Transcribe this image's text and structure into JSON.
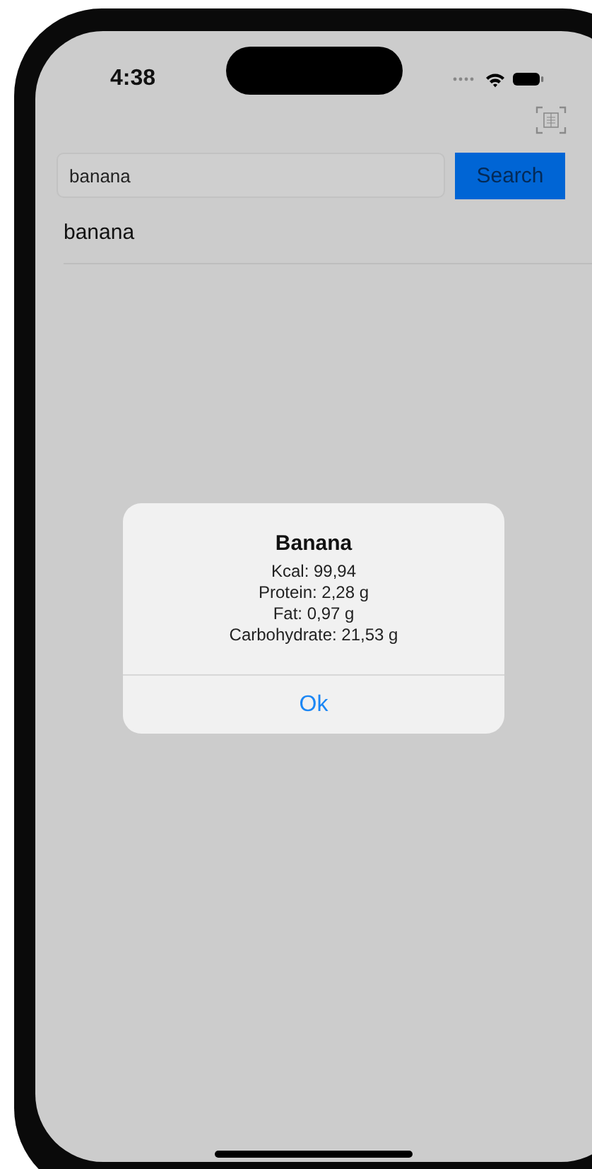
{
  "status_bar": {
    "time": "4:38"
  },
  "search": {
    "value": "banana",
    "button": "Search"
  },
  "results": [
    {
      "label": "banana"
    }
  ],
  "alert": {
    "title": "Banana",
    "lines": [
      "Kcal: 99,94",
      "Protein: 2,28 g",
      "Fat: 0,97 g",
      "Carbohydrate: 21,53 g"
    ],
    "button": "Ok"
  }
}
